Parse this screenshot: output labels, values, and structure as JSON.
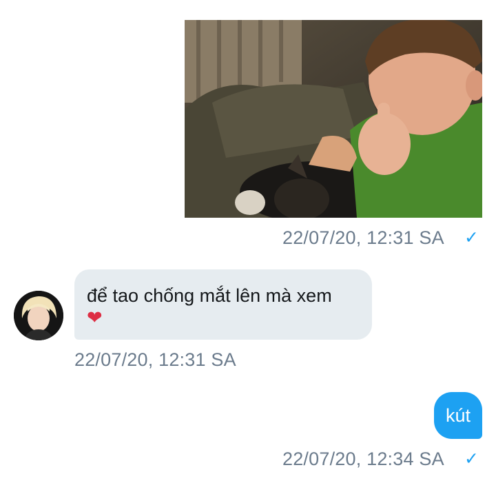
{
  "messages": [
    {
      "direction": "outgoing",
      "type": "photo",
      "timestamp": "22/07/20, 12:31 SA",
      "status": "sent",
      "status_icon": "checkmark-icon",
      "status_glyph": "✓"
    },
    {
      "direction": "incoming",
      "type": "text",
      "text": "để tao chống mắt lên mà xem",
      "emoji": "❤",
      "timestamp": "22/07/20, 12:31 SA"
    },
    {
      "direction": "outgoing",
      "type": "text",
      "text": "kút",
      "timestamp": "22/07/20, 12:34 SA",
      "status": "sent",
      "status_icon": "checkmark-icon",
      "status_glyph": "✓"
    }
  ],
  "colors": {
    "outgoing_bubble": "#1da1f2",
    "incoming_bubble": "#e6ecf0",
    "timestamp": "#6b7b8c",
    "check": "#1da1f2"
  }
}
